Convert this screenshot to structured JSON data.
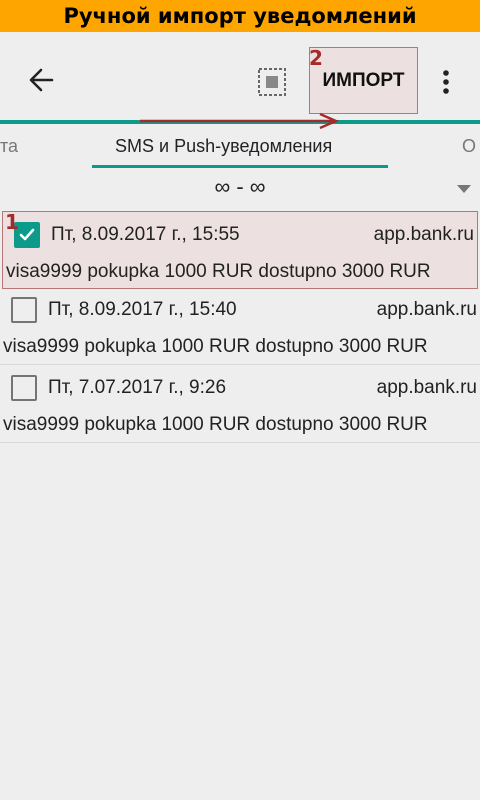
{
  "banner": {
    "title": "Ручной импорт уведомлений"
  },
  "toolbar": {
    "back_icon": "arrow-left-icon",
    "select_all_icon": "select-all-icon",
    "import_label": "ИМПОРТ",
    "menu_icon": "more-vert-icon"
  },
  "annotations": {
    "step1": "1",
    "step2": "2",
    "color": "#a52a2a"
  },
  "tabs": {
    "items": [
      {
        "label": "та"
      },
      {
        "label": "SMS и Push-уведомления"
      },
      {
        "label": "О"
      }
    ],
    "active_index": 1
  },
  "range": {
    "label": "∞ - ∞"
  },
  "notifications": [
    {
      "checked": true,
      "date": "Пт, 8.09.2017 г., 15:55",
      "sender": "app.bank.ru",
      "text": "visa9999 pokupka 1000 RUR dostupno 3000 RUR"
    },
    {
      "checked": false,
      "date": "Пт, 8.09.2017 г., 15:40",
      "sender": "app.bank.ru",
      "text": "visa9999 pokupka 1000 RUR dostupno 3000 RUR"
    },
    {
      "checked": false,
      "date": "Пт, 7.07.2017 г., 9:26",
      "sender": "app.bank.ru",
      "text": "visa9999 pokupka 1000 RUR dostupno 3000 RUR"
    }
  ],
  "colors": {
    "accent": "#0c9a8a",
    "banner": "#ffa500",
    "highlight": "#ece0e0"
  }
}
